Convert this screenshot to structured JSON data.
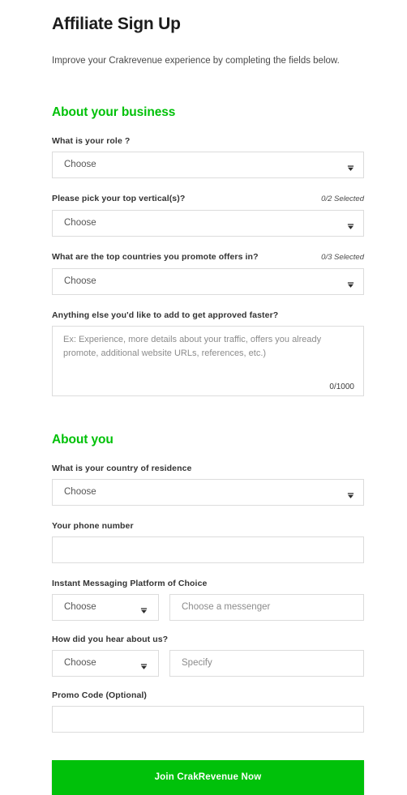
{
  "header": {
    "title": "Affiliate Sign Up",
    "subtitle": "Improve your Crakrevenue experience by completing the fields below."
  },
  "colors": {
    "accent_green": "#00c108",
    "button_green": "#00c10a",
    "label": "#333333",
    "border": "#dcdcdc",
    "placeholder": "#8c8c8c"
  },
  "sections": {
    "business": {
      "heading": "About your business",
      "role": {
        "label": "What is your role ?",
        "value": "Choose",
        "caret": "chevron-down-icon"
      },
      "verticals": {
        "label": "Please pick your top vertical(s)?",
        "counter": "0/2 Selected",
        "value": "Choose",
        "caret": "chevron-down-icon"
      },
      "countries": {
        "label": "What are the top countries you promote offers in?",
        "counter": "0/3 Selected",
        "value": "Choose",
        "caret": "chevron-down-icon"
      },
      "notes": {
        "label": "Anything else you'd like to add to get approved faster?",
        "placeholder": "Ex: Experience, more details about your traffic, offers you already promote, additional website URLs, references, etc.)",
        "value": "",
        "counter": "0/1000"
      }
    },
    "you": {
      "heading": "About you",
      "country": {
        "label": "What is your country of residence",
        "value": "Choose",
        "caret": "chevron-down-icon"
      },
      "phone": {
        "label": "Your phone number",
        "value": "",
        "placeholder": ""
      },
      "messaging": {
        "label": "Instant Messaging Platform of Choice",
        "platform_value": "Choose",
        "platform_caret": "chevron-down-icon",
        "handle_placeholder": "Choose a messenger",
        "handle_value": ""
      },
      "referral": {
        "label": "How did you hear about us?",
        "source_value": "Choose",
        "source_caret": "chevron-down-icon",
        "specify_placeholder": "Specify",
        "specify_value": ""
      },
      "promo": {
        "label": "Promo Code (Optional)",
        "value": "",
        "placeholder": ""
      }
    }
  },
  "submit": {
    "label": "Join CrakRevenue Now"
  }
}
